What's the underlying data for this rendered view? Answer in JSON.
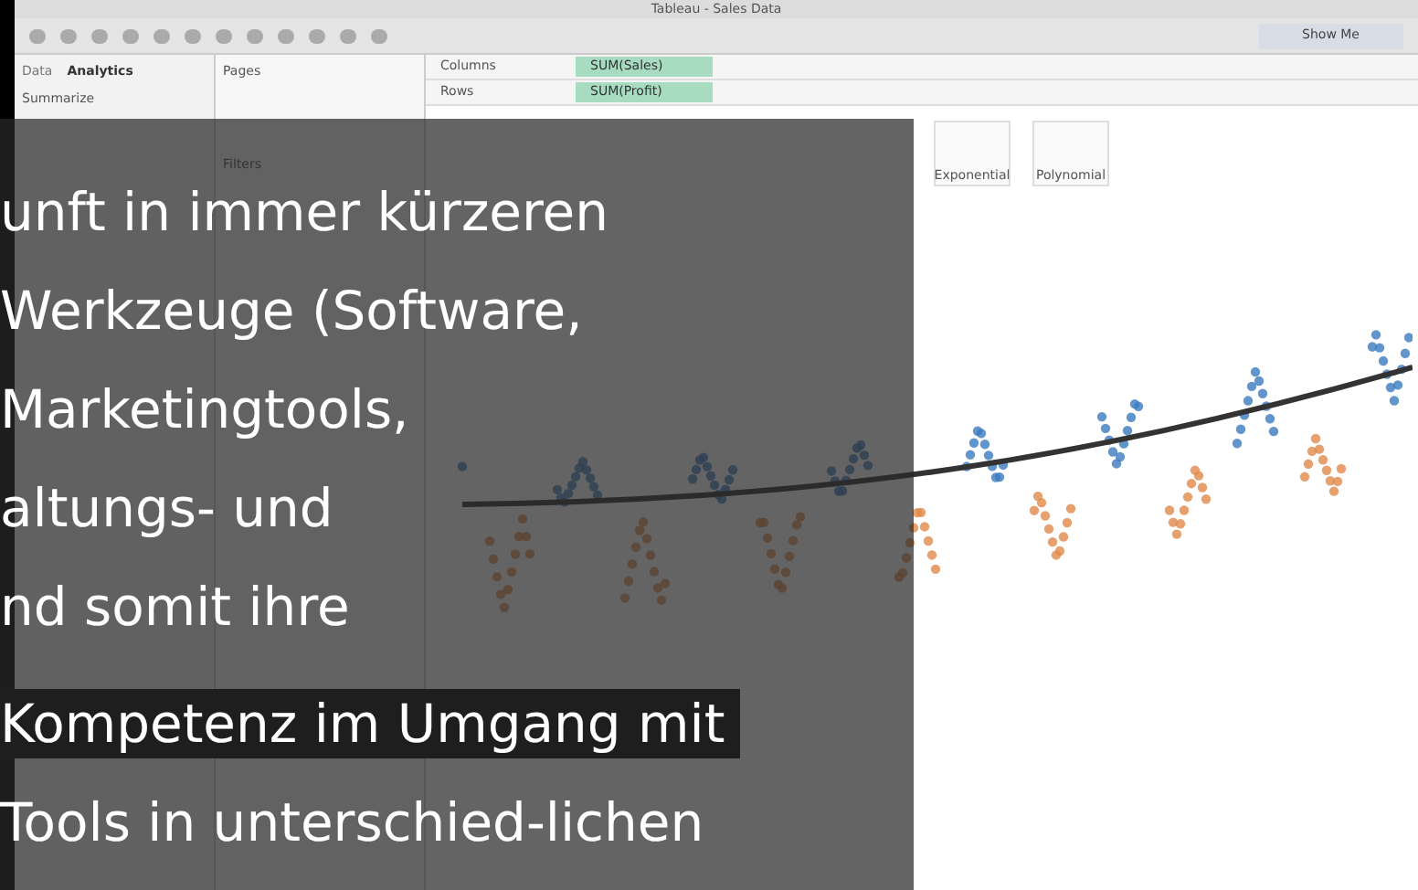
{
  "window": {
    "title": "Tableau - Sales Data"
  },
  "toolbar": {
    "show_me": "Show Me"
  },
  "side_tabs": [
    {
      "label": "Data",
      "selected": false
    },
    {
      "label": "Analytics",
      "selected": true
    }
  ],
  "side_heading": "Summarize",
  "shelves": {
    "pages": "Pages",
    "filters": "Filters",
    "columns": {
      "label": "Columns",
      "pill": "SUM(Sales)"
    },
    "rows": {
      "label": "Rows",
      "pill": "SUM(Profit)"
    }
  },
  "trend_options": [
    {
      "label": "Exponential"
    },
    {
      "label": "Polynomial"
    }
  ],
  "overlay": {
    "lines": [
      {
        "text": "unft in immer kürzeren",
        "highlighted": false
      },
      {
        "text": "Werkzeuge (Software,",
        "highlighted": false
      },
      {
        "text": "Marketingtools,",
        "highlighted": false
      },
      {
        "text": "altungs- und",
        "highlighted": false
      },
      {
        "text": "nd somit ihre",
        "highlighted": false
      },
      {
        "text": "Kompetenz im Umgang mit",
        "highlighted": true
      },
      {
        "text": "Tools in unterschied-lichen",
        "highlighted": false
      }
    ]
  }
}
